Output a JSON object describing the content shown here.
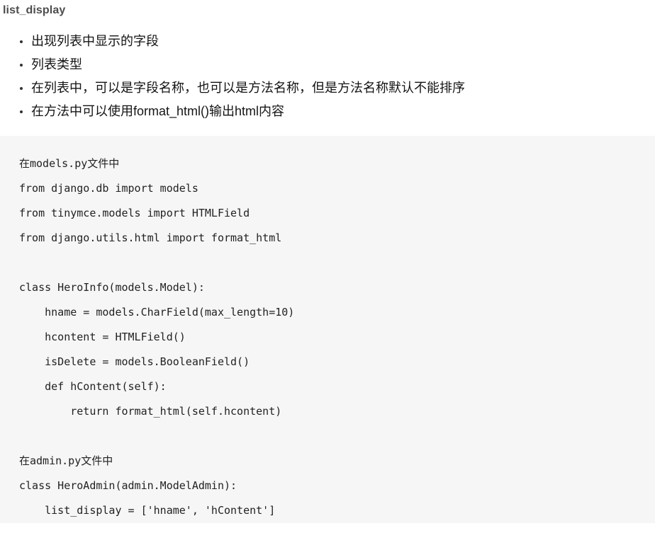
{
  "document": {
    "heading": "list_display",
    "bullets": [
      "出现列表中显示的字段",
      "列表类型",
      "在列表中，可以是字段名称，也可以是方法名称，但是方法名称默认不能排序",
      "在方法中可以使用format_html()输出html内容"
    ],
    "code_block": {
      "language": "python",
      "background_color": "#f6f6f6",
      "text_color": "#222222",
      "lines": [
        "在models.py文件中",
        "from django.db import models",
        "from tinymce.models import HTMLField",
        "from django.utils.html import format_html",
        "",
        "class HeroInfo(models.Model):",
        "    hname = models.CharField(max_length=10)",
        "    hcontent = HTMLField()",
        "    isDelete = models.BooleanField()",
        "    def hContent(self):",
        "        return format_html(self.hcontent)",
        "",
        "在admin.py文件中",
        "class HeroAdmin(admin.ModelAdmin):",
        "    list_display = ['hname', 'hContent']"
      ]
    }
  }
}
